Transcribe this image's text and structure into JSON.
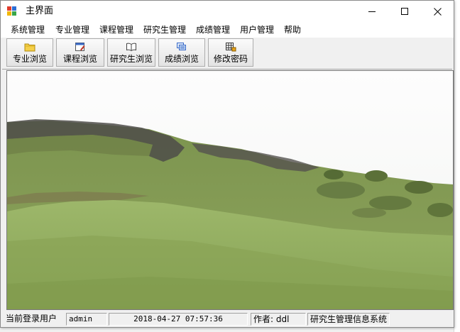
{
  "window": {
    "title": "主界面",
    "minimize_label": "",
    "maximize_label": "",
    "close_label": ""
  },
  "menu": {
    "items": [
      "系统管理",
      "专业管理",
      "课程管理",
      "研究生管理",
      "成绩管理",
      "用户管理",
      "帮助"
    ]
  },
  "toolbar": {
    "buttons": [
      {
        "label": "专业浏览",
        "icon": "folder-icon"
      },
      {
        "label": "课程浏览",
        "icon": "edit-window-icon"
      },
      {
        "label": "研究生浏览",
        "icon": "book-icon"
      },
      {
        "label": "成绩浏览",
        "icon": "stacked-documents-icon"
      },
      {
        "label": "修改密码",
        "icon": "grid-key-icon"
      }
    ]
  },
  "content": {
    "image": "grassy-hillside-landscape"
  },
  "status": {
    "user_label": "当前登录用户",
    "user_value": "admin",
    "datetime": "2018-04-27 07:57:36",
    "author": "作者: ddl",
    "system_name": "研究生管理信息系统"
  },
  "colors": {
    "titlebar": "#ffffff",
    "window_bg": "#f0f0f0",
    "sky": "#fdfdfd",
    "grass": "#8aa45a",
    "rock": "#4a4a48"
  }
}
